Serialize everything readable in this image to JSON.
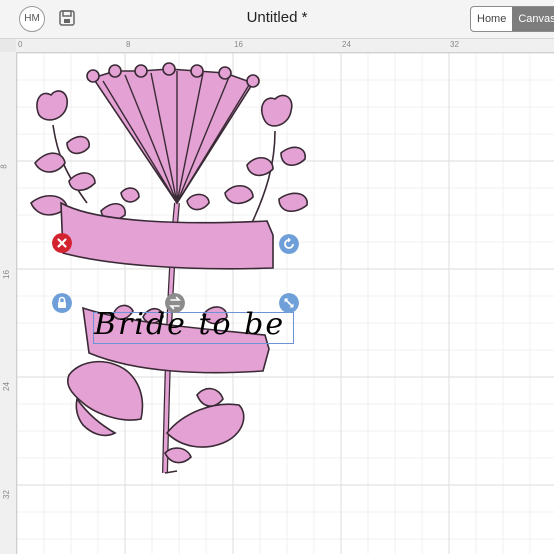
{
  "header": {
    "avatar_initials": "HM",
    "title": "Untitled *",
    "tabs": [
      {
        "label": "Home"
      },
      {
        "label": "Canvas"
      }
    ]
  },
  "rulers": {
    "top": [
      "0",
      "8",
      "16",
      "24",
      "32"
    ],
    "left": [
      "8",
      "16",
      "24",
      "32"
    ]
  },
  "canvas": {
    "text_object": "Bride to be",
    "colors": {
      "fill": "#e3a1d4",
      "stroke": "#3a2a36",
      "delete": "#d2232f",
      "handle": "#6f9fd8",
      "grid": "#e2e2e2"
    }
  },
  "icons": {
    "save": "save-icon",
    "delete": "close-icon",
    "rotate": "rotate-icon",
    "lock": "lock-icon",
    "resize": "resize-icon",
    "move": "move-icon"
  }
}
